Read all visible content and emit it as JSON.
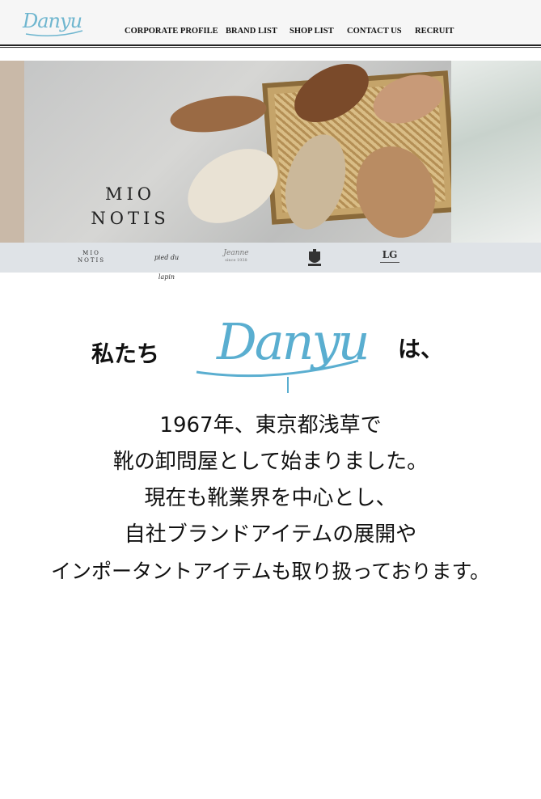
{
  "header": {
    "logo_text": "Danyu",
    "nav": [
      {
        "label": "CORPORATE PROFILE"
      },
      {
        "label": "BRAND LIST"
      },
      {
        "label": "SHOP LIST"
      },
      {
        "label": "CONTACT US"
      },
      {
        "label": "RECRUIT"
      }
    ]
  },
  "hero": {
    "brand_line1": "MIO",
    "brand_line2": "NOTIS"
  },
  "brand_bar": {
    "mio_line1": "MIO",
    "mio_line2": "NOTIS",
    "pied": "pied du lapin",
    "jeanne": "Jeanne",
    "jeanne_since": "since 1938",
    "lg": "LG"
  },
  "intro": {
    "prefix": "私たち",
    "logo_text": "Danyu",
    "suffix": "は、"
  },
  "body_lines": [
    "1967年、東京都浅草で",
    "靴の卸問屋として始まりました。",
    "現在も靴業界を中心とし、",
    "自社ブランドアイテムの展開や",
    "インポータントアイテムも取り扱っております。"
  ]
}
